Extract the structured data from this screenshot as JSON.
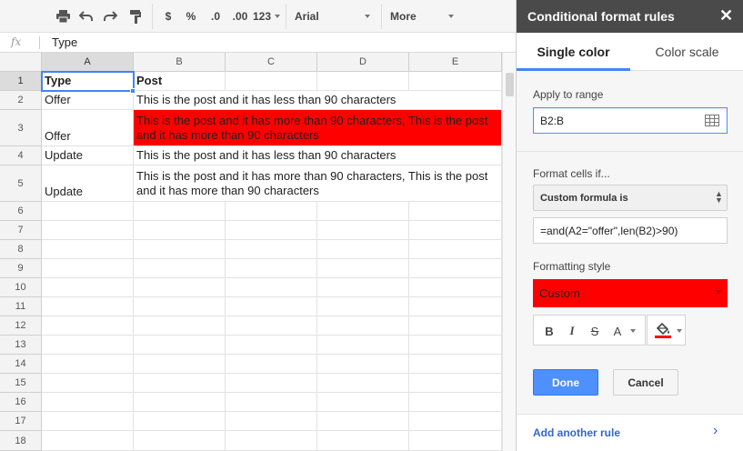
{
  "toolbar": {
    "currency": "$",
    "percent": "%",
    "dec_decrease": ".0",
    "dec_increase": ".00",
    "number_format": "123",
    "font": "Arial",
    "more": "More"
  },
  "formula_bar": {
    "fx_label": "fx",
    "content": "Type"
  },
  "grid": {
    "columns": [
      "A",
      "B",
      "C",
      "D",
      "E"
    ],
    "rows": [
      "1",
      "2",
      "3",
      "4",
      "5",
      "6",
      "7",
      "8",
      "9",
      "10",
      "11",
      "12",
      "13",
      "14",
      "15",
      "16",
      "17",
      "18"
    ],
    "cells": {
      "A1": "Type",
      "B1": "Post",
      "A2": "Offer",
      "B2": "This is the post and it has less than 90 characters",
      "A3": "Offer",
      "B3": "This is the post and it has more than 90 characters, This is the post and it has more than 90 characters",
      "A4": "Update",
      "B4": "This is the post and it has less than 90 characters",
      "A5": "Update",
      "B5": "This is the post and it has more than 90 characters, This is the post and it has more than 90 characters"
    },
    "highlight_color": "#ff0000",
    "selection_color": "#4285f4"
  },
  "panel": {
    "title": "Conditional format rules",
    "close": "✕",
    "tabs": [
      {
        "label": "Single color",
        "active": true
      },
      {
        "label": "Color scale",
        "active": false
      }
    ],
    "apply_label": "Apply to range",
    "range_value": "B2:B",
    "format_if_label": "Format cells if...",
    "condition": "Custom formula is",
    "formula": "=and(A2=\"offer\",len(B2)>90)",
    "style_label": "Formatting style",
    "style_value": "Custom",
    "style_color": "#ff0000",
    "fmt_bold": "B",
    "fmt_italic": "I",
    "fmt_strike": "S",
    "fmt_textcolor": "A",
    "done": "Done",
    "cancel": "Cancel",
    "add_rule": "Add another rule",
    "accent": "#4285f4"
  }
}
